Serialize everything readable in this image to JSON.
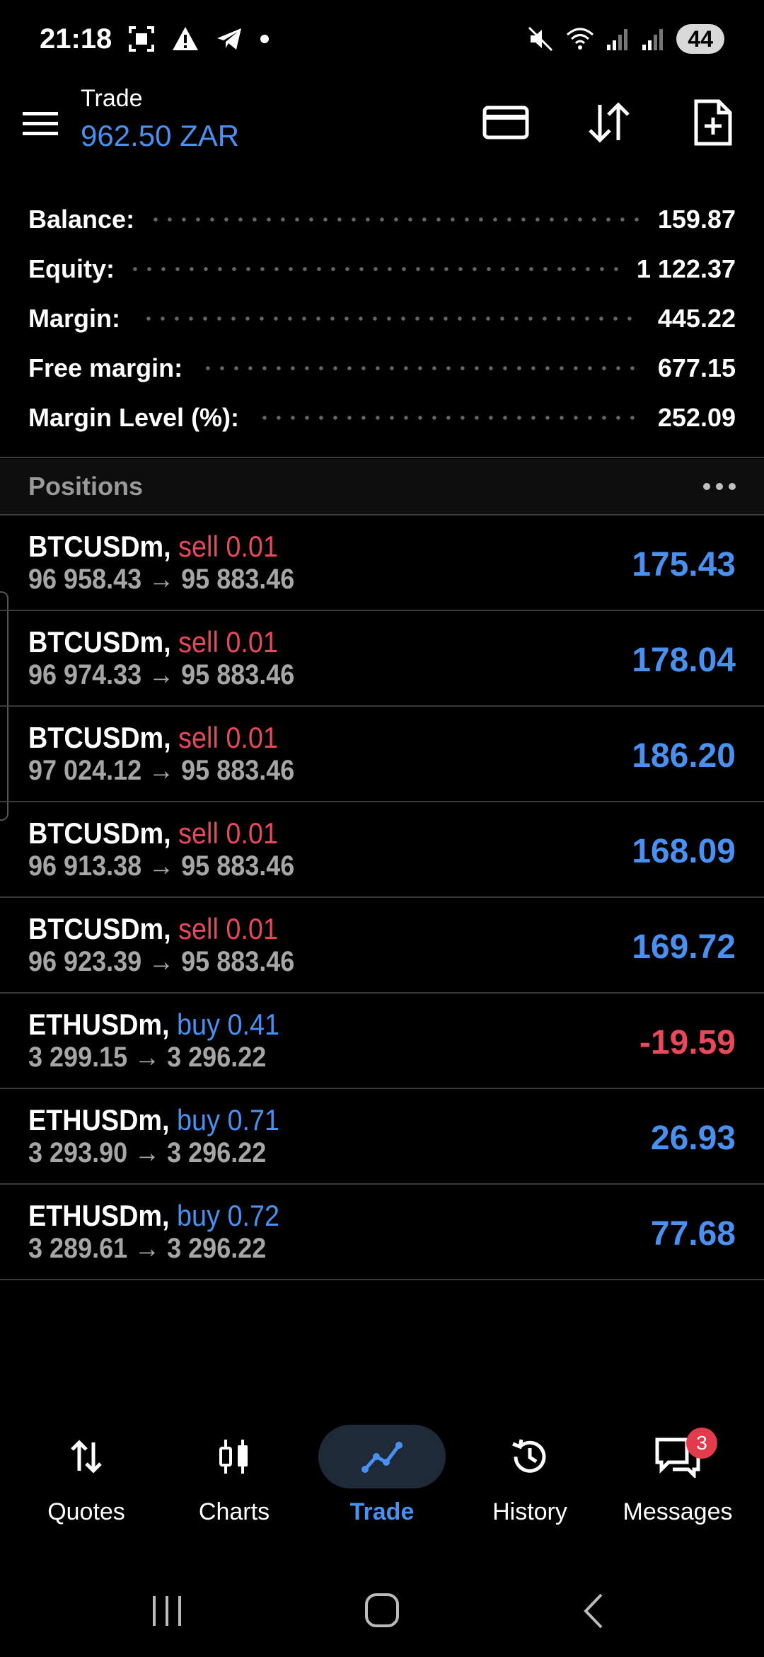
{
  "status": {
    "time": "21:18",
    "battery": "44"
  },
  "header": {
    "title": "Trade",
    "balance": "962.50 ZAR"
  },
  "summary": [
    {
      "label": "Balance:",
      "value": "159.87"
    },
    {
      "label": "Equity:",
      "value": "1 122.37"
    },
    {
      "label": "Margin:",
      "value": "445.22"
    },
    {
      "label": "Free margin:",
      "value": "677.15"
    },
    {
      "label": "Margin Level (%):",
      "value": "252.09"
    }
  ],
  "positions": {
    "title": "Positions",
    "items": [
      {
        "symbol": "BTCUSDm,",
        "side": "sell 0.01",
        "prices": "96 958.43 → 95 883.46",
        "profit": "175.43"
      },
      {
        "symbol": "BTCUSDm,",
        "side": "sell 0.01",
        "prices": "96 974.33 → 95 883.46",
        "profit": "178.04"
      },
      {
        "symbol": "BTCUSDm,",
        "side": "sell 0.01",
        "prices": "97 024.12 → 95 883.46",
        "profit": "186.20"
      },
      {
        "symbol": "BTCUSDm,",
        "side": "sell 0.01",
        "prices": "96 913.38 → 95 883.46",
        "profit": "168.09"
      },
      {
        "symbol": "BTCUSDm,",
        "side": "sell 0.01",
        "prices": "96 923.39 → 95 883.46",
        "profit": "169.72"
      },
      {
        "symbol": "ETHUSDm,",
        "side": "buy 0.41",
        "prices": "3 299.15 → 3 296.22",
        "profit": "-19.59"
      },
      {
        "symbol": "ETHUSDm,",
        "side": "buy 0.71",
        "prices": "3 293.90 → 3 296.22",
        "profit": "26.93"
      },
      {
        "symbol": "ETHUSDm,",
        "side": "buy 0.72",
        "prices": "3 289.61 → 3 296.22",
        "profit": "77.68"
      }
    ]
  },
  "nav": {
    "quotes": "Quotes",
    "charts": "Charts",
    "trade": "Trade",
    "history": "History",
    "messages": "Messages",
    "messages_badge": "3"
  },
  "colors": {
    "accent": "#4a90f0",
    "sell": "#e8485a",
    "background": "#000000"
  }
}
